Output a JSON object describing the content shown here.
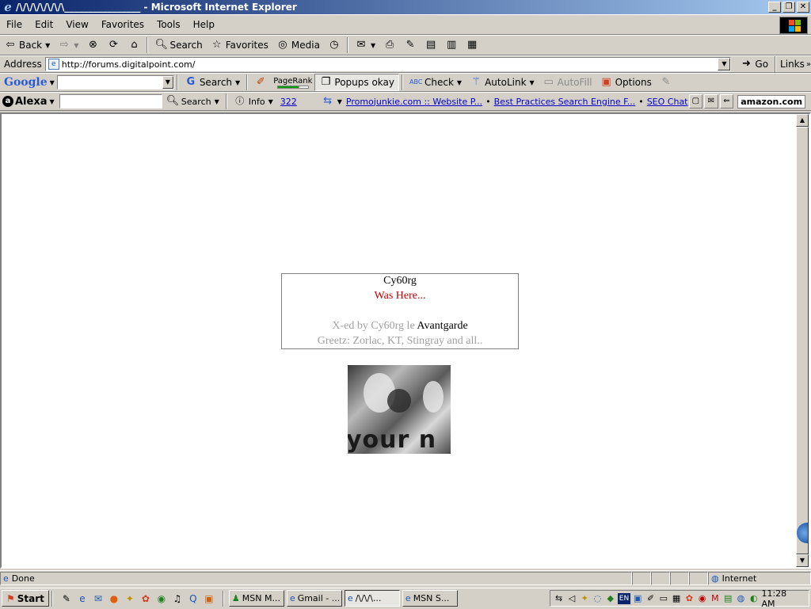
{
  "window": {
    "title": "/\\/\\/\\/\\/\\/\\/\\________________ - Microsoft Internet Explorer"
  },
  "menu": {
    "items": [
      "File",
      "Edit",
      "View",
      "Favorites",
      "Tools",
      "Help"
    ]
  },
  "toolbar": {
    "back_label": "Back",
    "search_label": "Search",
    "favorites_label": "Favorites",
    "media_label": "Media"
  },
  "address": {
    "label": "Address",
    "url": "http://forums.digitalpoint.com/",
    "go_label": "Go",
    "links_label": "Links"
  },
  "google_bar": {
    "logo": "Google",
    "search_label": "Search",
    "pagerank_label": "PageRank",
    "pagerank_level": 0.7,
    "popups_label": "Popups okay",
    "check_label": "Check",
    "autolink_label": "AutoLink",
    "autofill_label": "AutoFill",
    "options_label": "Options"
  },
  "alexa_bar": {
    "logo": "Alexa",
    "search_label": "Search",
    "info_label": "Info",
    "rank": "322",
    "links": [
      "Promojunkie.com :: Website P...",
      "Best Practices Search Engine F...",
      "SEO Chat"
    ],
    "amazon_label": "amazon.com"
  },
  "page": {
    "line1": "Cy60rg",
    "line2": "Was Here...",
    "line3_prefix": "X-ed by Cy60rg le ",
    "line3_group": "Avantgarde",
    "line4": "Greetz: Zorlac, KT, Stingray and all..",
    "image_text": "your n"
  },
  "status": {
    "text": "Done",
    "zone": "Internet"
  },
  "taskbar": {
    "start_label": "Start",
    "tasks": [
      "MSN M...",
      "Gmail - ...",
      "/\\/\\/\\...",
      "MSN S..."
    ],
    "tray_lang": "EN",
    "clock": "11:28 AM"
  },
  "colors": {
    "title_gradient_start": "#0a246a",
    "chrome": "#d4d0c8",
    "hack_red": "#c00000",
    "link_blue": "#0000cc"
  }
}
